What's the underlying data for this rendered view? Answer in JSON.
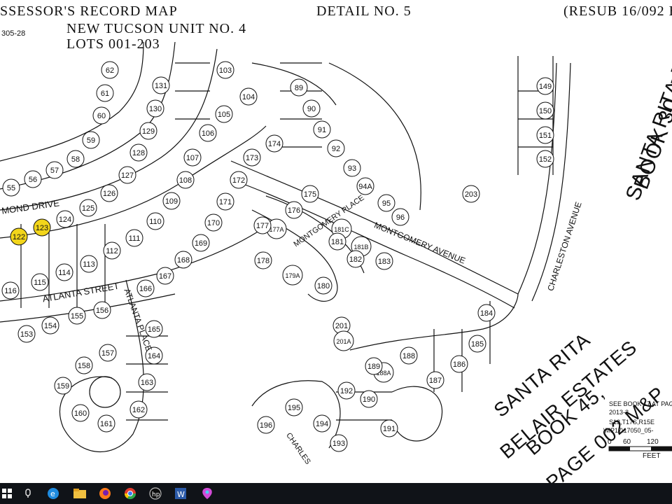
{
  "header": {
    "title_left": "SSESSOR'S RECORD MAP",
    "detail": "DETAIL NO. 5",
    "resub": "(RESUB 16/092 B",
    "subtitle1": "NEW TUCSON UNIT NO. 4",
    "subtitle2": "LOTS 001-203",
    "ref_code": "305-28"
  },
  "streets": {
    "mond_drive": "MOND DRIVE",
    "atlanta_street": "ATLANTA STREET",
    "atlanta_place": "ATLANTA PLACE",
    "montgomery_place": "MONTGOMERY PLACE",
    "montgomery_avenue": "MONTGOMERY AVENUE",
    "charleston_avenue": "CHARLESTON AVENUE",
    "charleston": "CHARLES"
  },
  "right_labels": {
    "santa_rita_1": "SANTA RITA B",
    "santa_rita_2": "BOOK 30, P",
    "belair_1": "SANTA RITA",
    "belair_2": "BELAIR ESTATES",
    "belair_3": "BOOK 45,",
    "belair_4": "PAGE 002 M&P"
  },
  "notes": {
    "see_book": "SEE BOOK 17 AT PAGE",
    "year": "2013-2",
    "section": "S13,T17S,R15E",
    "file": "\\MP17\\17050_05-",
    "scale_0": "0",
    "scale_60": "60",
    "scale_120": "120",
    "feet": "FEET"
  },
  "lots": [
    "62",
    "61",
    "60",
    "59",
    "58",
    "57",
    "56",
    "55",
    "131",
    "130",
    "129",
    "128",
    "127",
    "126",
    "125",
    "124",
    "123",
    "122",
    "103",
    "104",
    "105",
    "106",
    "107",
    "108",
    "109",
    "110",
    "111",
    "112",
    "113",
    "114",
    "115",
    "116",
    "89",
    "90",
    "91",
    "92",
    "93",
    "94A",
    "95",
    "96",
    "173",
    "174",
    "175",
    "176",
    "172",
    "171",
    "170",
    "169",
    "168",
    "167",
    "166",
    "165",
    "164",
    "163",
    "162",
    "161",
    "160",
    "159",
    "158",
    "157",
    "156",
    "155",
    "154",
    "153",
    "177A",
    "177",
    "178",
    "179A",
    "180",
    "181C",
    "181",
    "181B",
    "182",
    "183",
    "184",
    "185",
    "186",
    "187",
    "188A",
    "188",
    "189",
    "190",
    "191",
    "192",
    "193",
    "194",
    "195",
    "196",
    "201",
    "201A",
    "203",
    "149",
    "150",
    "151",
    "152"
  ],
  "highlighted_lots": [
    "122",
    "123"
  ],
  "highlight_color": "#f2d51b",
  "taskbar": {
    "items": [
      "windows-start-icon",
      "search-icon",
      "task-view-icon",
      "edge-icon",
      "file-explorer-icon",
      "firefox-icon",
      "chrome-icon",
      "hp-icon",
      "word-icon",
      "paint-icon"
    ]
  }
}
